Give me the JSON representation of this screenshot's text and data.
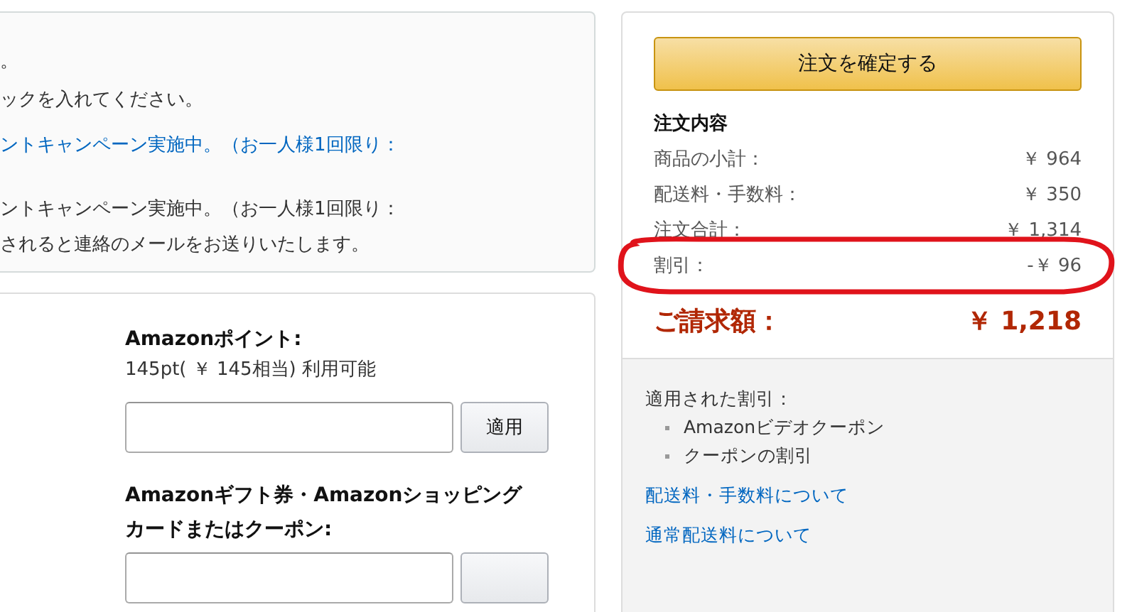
{
  "notice_panel": {
    "lines": [
      {
        "kind": "plain",
        "text": "。"
      },
      {
        "kind": "plain",
        "text": "ックを入れてください。"
      },
      {
        "kind": "link",
        "text": "ントキャンペーン実施中。（お一人様1回限り："
      },
      {
        "kind": "gap"
      },
      {
        "kind": "plain",
        "text": "ントキャンペーン実施中。（お一人様1回限り："
      },
      {
        "kind": "plain",
        "text": "されると連絡のメールをお送りいたします。"
      }
    ]
  },
  "payment_panel": {
    "sections": [
      {
        "title": "Amazonポイント:",
        "note": "145pt( ￥ 145相当) 利用可能",
        "button": "適用"
      },
      {
        "title": "Amazonギフト券・Amazonショッピングカードまたはクーポン:"
      }
    ]
  },
  "order_summary": {
    "place_order_button": "注文を確定する",
    "heading": "注文内容",
    "rows": [
      {
        "label": "商品の小計：",
        "value": "￥ 964",
        "highlighted": false
      },
      {
        "label": "配送料・手数料：",
        "value": "￥ 350",
        "highlighted": false
      },
      {
        "label": "注文合計：",
        "value": "￥ 1,314",
        "highlighted": false
      },
      {
        "label": "割引：",
        "value": "-￥ 96",
        "highlighted": true
      }
    ],
    "total_label": "ご請求額：",
    "total_value": "￥ 1,218",
    "applied_discounts_label": "適用された割引：",
    "applied_discounts": [
      "Amazonビデオクーポン",
      "クーポンの割引"
    ],
    "links": [
      "配送料・手数料について",
      "通常配送料について"
    ]
  }
}
